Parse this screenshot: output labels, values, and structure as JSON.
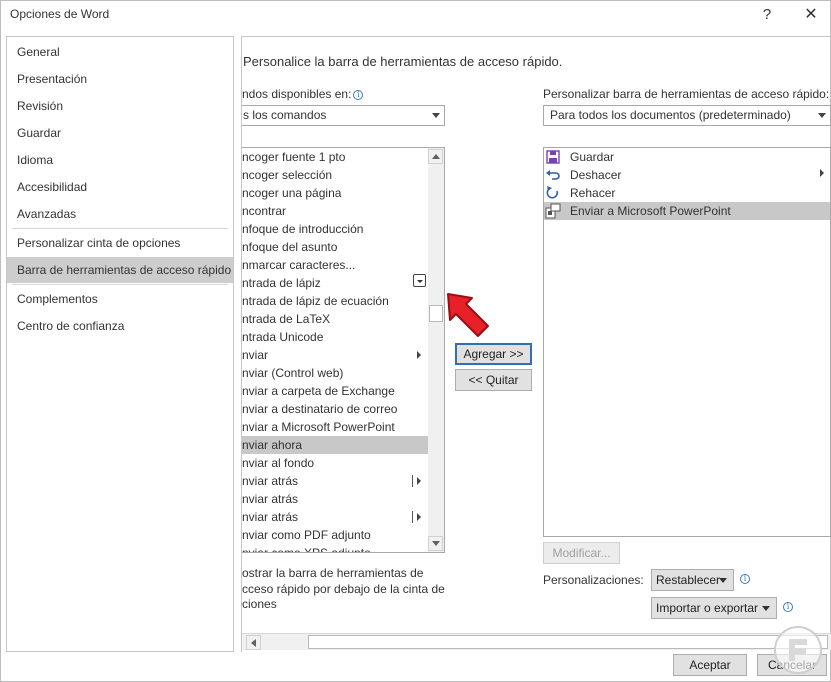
{
  "window": {
    "title": "Opciones de Word",
    "help": "?",
    "close": "✕"
  },
  "nav": {
    "items": [
      {
        "label": "General"
      },
      {
        "label": "Presentación"
      },
      {
        "label": "Revisión"
      },
      {
        "label": "Guardar"
      },
      {
        "label": "Idioma"
      },
      {
        "label": "Accesibilidad"
      },
      {
        "label": "Avanzadas"
      },
      {
        "label": "Personalizar cinta de opciones"
      },
      {
        "label": "Barra de herramientas de acceso rápido"
      },
      {
        "label": "Complementos"
      },
      {
        "label": "Centro de confianza"
      }
    ],
    "selected": "Barra de herramientas de acceso rápido"
  },
  "main": {
    "heading": "Personalice la barra de herramientas de acceso rápido.",
    "commands_label": "ndos disponibles en:",
    "commands_combo": "s los comandos",
    "customize_label": "Personalizar barra de herramientas de acceso rápido:",
    "customize_combo": "Para todos los documentos (predeterminado)",
    "commands": [
      {
        "label": "ncoger fuente 1 pto"
      },
      {
        "label": "ncoger selección"
      },
      {
        "label": "ncoger una página"
      },
      {
        "label": "ncontrar"
      },
      {
        "label": "nfoque de introducción"
      },
      {
        "label": "nfoque del asunto"
      },
      {
        "label": "nmarcar caracteres..."
      },
      {
        "label": "ntrada de lápiz"
      },
      {
        "label": "ntrada de lápiz de ecuación"
      },
      {
        "label": "ntrada de LaTeX"
      },
      {
        "label": "ntrada Unicode"
      },
      {
        "label": "nviar"
      },
      {
        "label": "nviar (Control web)"
      },
      {
        "label": "nviar a carpeta de Exchange"
      },
      {
        "label": "nviar a destinatario de correo"
      },
      {
        "label": "nviar a Microsoft PowerPoint"
      },
      {
        "label": "nviar ahora"
      },
      {
        "label": "nviar al fondo"
      },
      {
        "label": "nviar atrás"
      },
      {
        "label": "nviar atrás"
      },
      {
        "label": "nviar atrás"
      },
      {
        "label": "nviar como PDF adjunto"
      },
      {
        "label": "nviar como XPS adjunto"
      }
    ],
    "selected_command": "nviar ahora",
    "add_button": "Agregar >>",
    "remove_button": "<< Quitar",
    "qat_items": [
      {
        "label": "Guardar",
        "icon": "save-icon"
      },
      {
        "label": "Deshacer",
        "icon": "undo-icon"
      },
      {
        "label": "Rehacer",
        "icon": "redo-icon"
      },
      {
        "label": "Enviar a Microsoft PowerPoint",
        "icon": "powerpoint-send-icon"
      }
    ],
    "modify_button": "Modificar...",
    "show_below_line1": "ostrar la barra de herramientas de",
    "show_below_line2": "cceso rápido por debajo de la cinta de",
    "show_below_line3": "ciones",
    "customizations_label": "Personalizaciones:",
    "reset_button": "Restablecer",
    "import_export_button": "Importar o exportar"
  },
  "footer": {
    "ok": "Aceptar",
    "cancel": "Cancelar"
  },
  "colors": {
    "selection": "#cdcdcd",
    "accent_border": "#2f6fb8",
    "arrow_red": "#e8202a"
  }
}
